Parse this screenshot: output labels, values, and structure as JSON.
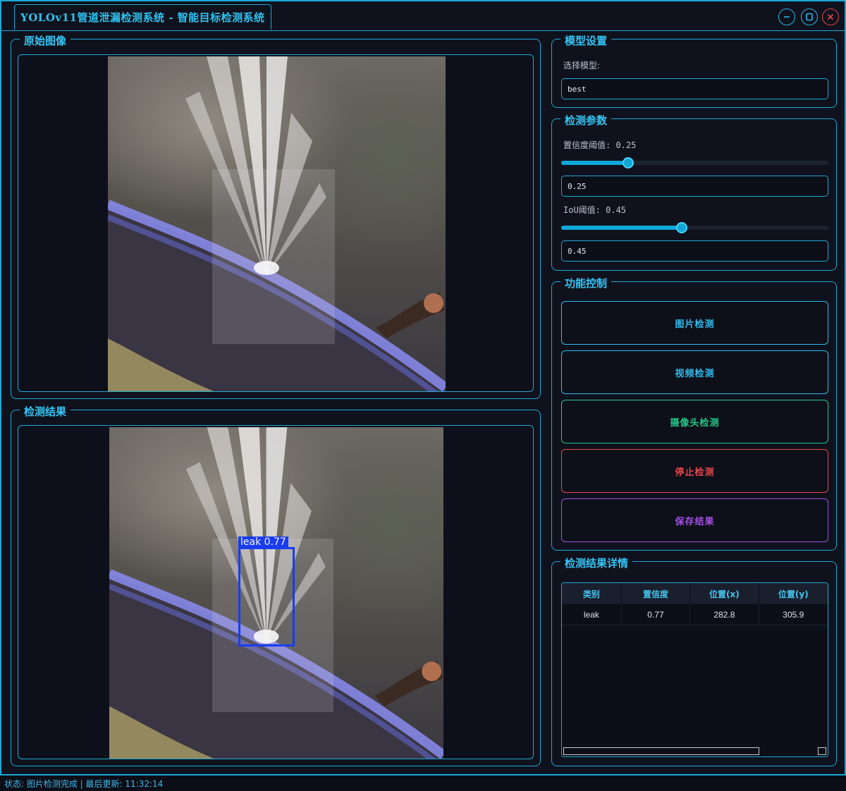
{
  "window": {
    "title": "YOLOv11管道泄漏检测系统 - 智能目标检测系统",
    "controls": {
      "minimize_icon": "minimize-icon",
      "maximize_icon": "maximize-icon",
      "close_icon": "close-icon"
    }
  },
  "original_panel": {
    "title": "原始图像"
  },
  "result_panel": {
    "title": "检测结果"
  },
  "detection_overlay": {
    "label": "leak 0.77",
    "color": "#1a3cf0"
  },
  "model_settings": {
    "title": "模型设置",
    "select_label": "选择模型:",
    "selected_model": "best"
  },
  "detect_params": {
    "title": "检测参数",
    "conf_label": "置信度阈值: 0.25",
    "conf_value": "0.25",
    "conf_level": 0.25,
    "iou_label": "IoU阈值: 0.45",
    "iou_value": "0.45",
    "iou_level": 0.45
  },
  "function_control": {
    "title": "功能控制",
    "buttons": [
      {
        "label": "图片检测",
        "color": "#2fbdf0"
      },
      {
        "label": "视频检测",
        "color": "#2fbdf0"
      },
      {
        "label": "摄像头检测",
        "color": "#22c98a"
      },
      {
        "label": "停止检测",
        "color": "#e8474b"
      },
      {
        "label": "保存结果",
        "color": "#a64ee8"
      }
    ]
  },
  "results_detail": {
    "title": "检测结果详情",
    "columns": [
      "类别",
      "置信度",
      "位置(x)",
      "位置(y)"
    ],
    "rows": [
      [
        "leak",
        "0.77",
        "282.8",
        "305.9"
      ]
    ]
  },
  "status_bar": {
    "text": "状态: 图片检测完成 | 最后更新: 11:32:14"
  }
}
